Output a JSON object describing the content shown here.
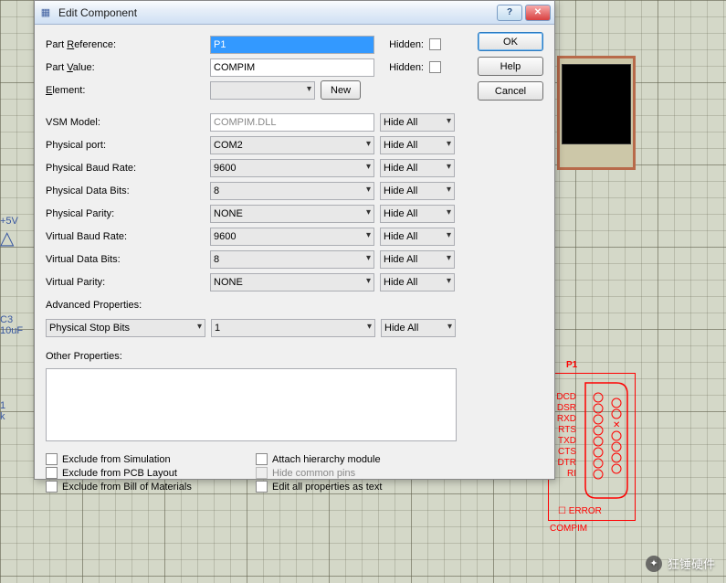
{
  "title": "Edit Component",
  "header": {
    "help_glyph": "?",
    "close_glyph": "✕"
  },
  "labels": {
    "part_ref_pre": "Part ",
    "part_ref_u": "R",
    "part_ref_post": "eference:",
    "part_val_pre": "Part ",
    "part_val_u": "V",
    "part_val_post": "alue:",
    "element_u": "E",
    "element_post": "lement:",
    "new_u": "N",
    "new_post": "ew",
    "hidden": "Hidden:",
    "vsm_model": "VSM Model:",
    "physical_port": "Physical port:",
    "physical_baud": "Physical Baud Rate:",
    "physical_data_bits": "Physical Data Bits:",
    "physical_parity": "Physical Parity:",
    "virtual_baud": "Virtual Baud Rate:",
    "virtual_data_bits": "Virtual Data Bits:",
    "virtual_parity": "Virtual Parity:",
    "advanced": "Advanced Properties:",
    "other": "Other Properties:"
  },
  "fields": {
    "part_ref": "P1",
    "part_value": "COMPIM",
    "vsm_model": "COMPIM.DLL",
    "physical_port": "COM2",
    "physical_baud": "9600",
    "physical_data_bits": "8",
    "physical_parity": "NONE",
    "virtual_baud": "9600",
    "virtual_data_bits": "8",
    "virtual_parity": "NONE",
    "adv_key": "Physical Stop Bits",
    "adv_val": "1"
  },
  "hideall": "Hide All",
  "buttons": {
    "ok_u": "O",
    "ok_post": "K",
    "help_u": "H",
    "help_post": "elp",
    "cancel_u": "C",
    "cancel_post": "ancel"
  },
  "checks": {
    "excl_sim": "Exclude from Simulation",
    "excl_pcb": "Exclude from PCB Layout",
    "excl_bom": "Exclude from Bill of Materials",
    "attach": "Attach hierarchy module",
    "hide_common": "Hide common pins",
    "edit_all": "Edit all properties as text"
  },
  "bg": {
    "voltage": "+5V",
    "c3_a": "C3",
    "c3_b": "10uF",
    "one_a": "1",
    "one_b": "k"
  },
  "compim": {
    "title": "P1",
    "pins": [
      "DCD",
      "DSR",
      "RXD",
      "RTS",
      "TXD",
      "CTS",
      "DTR",
      "RI"
    ],
    "error": "ERROR",
    "name": "COMPIM"
  },
  "watermark": "狂锤硬件"
}
